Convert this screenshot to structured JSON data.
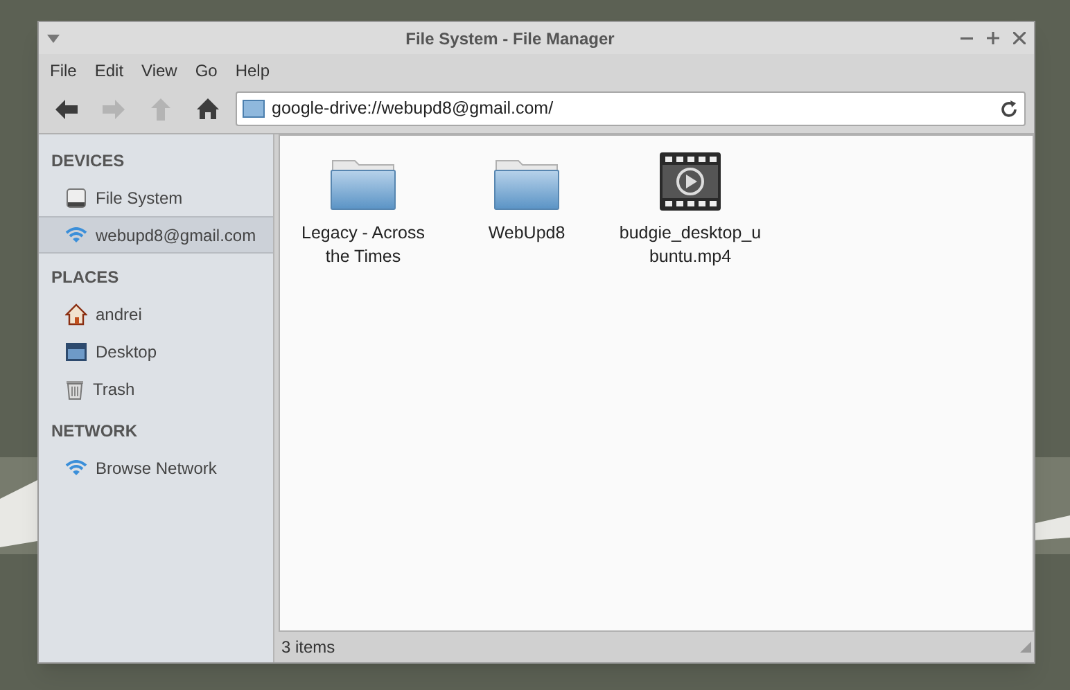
{
  "window": {
    "title": "File System - File Manager"
  },
  "menu": [
    "File",
    "Edit",
    "View",
    "Go",
    "Help"
  ],
  "toolbar": {
    "buttons": [
      {
        "kind": "back",
        "disabled": false
      },
      {
        "kind": "forward",
        "disabled": true
      },
      {
        "kind": "up",
        "disabled": true
      },
      {
        "kind": "home",
        "disabled": false
      }
    ],
    "location": "google-drive://webupd8@gmail.com/"
  },
  "sidebar": [
    {
      "heading": "DEVICES",
      "items": [
        {
          "label": "File System",
          "kind": "drive",
          "selected": false
        },
        {
          "label": "webupd8@gmail.com",
          "kind": "network",
          "selected": true
        }
      ]
    },
    {
      "heading": "PLACES",
      "items": [
        {
          "label": "andrei",
          "kind": "home",
          "selected": false
        },
        {
          "label": "Desktop",
          "kind": "desktop",
          "selected": false
        },
        {
          "label": "Trash",
          "kind": "trash",
          "selected": false
        }
      ]
    },
    {
      "heading": "NETWORK",
      "items": [
        {
          "label": "Browse Network",
          "kind": "network",
          "selected": false
        }
      ]
    }
  ],
  "files": [
    {
      "name": "Legacy - Across the Times",
      "kind": "folder"
    },
    {
      "name": "WebUpd8",
      "kind": "folder"
    },
    {
      "name": "budgie_desktop_ubuntu.mp4",
      "kind": "video"
    }
  ],
  "status_bar": "3 items"
}
